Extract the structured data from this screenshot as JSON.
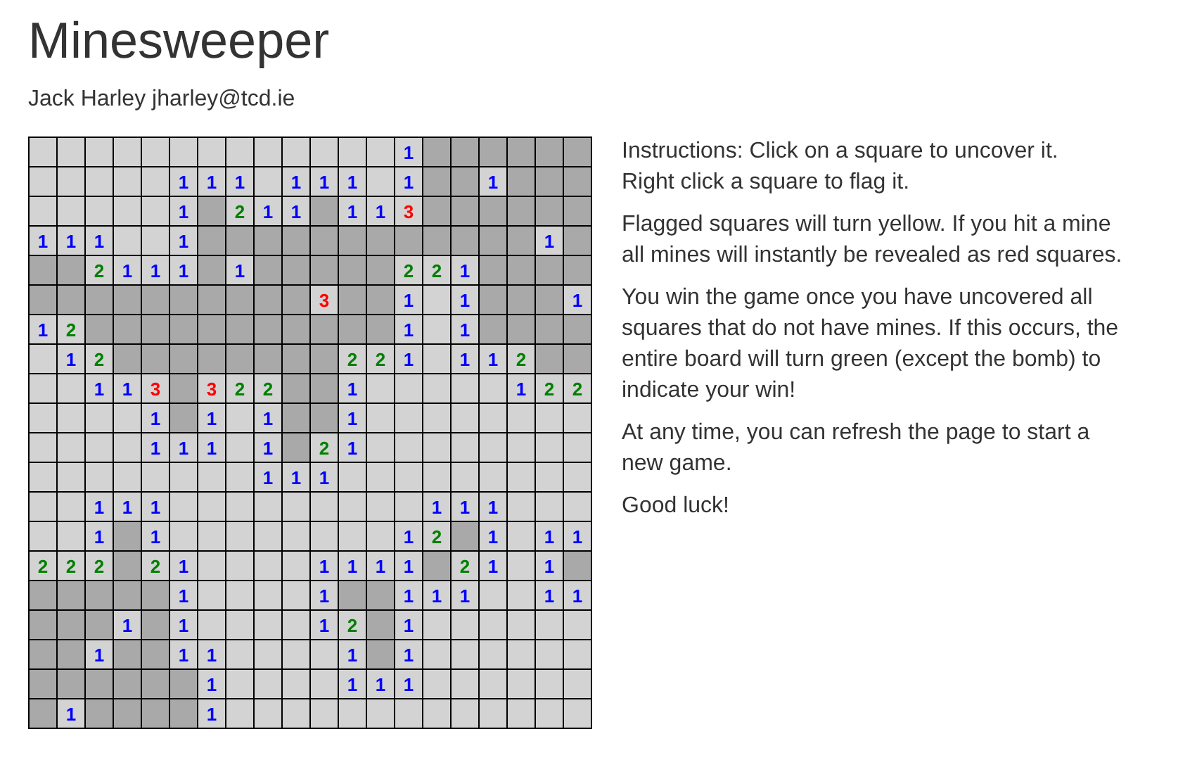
{
  "title": "Minesweeper",
  "author": "Jack Harley jharley@tcd.ie",
  "board": {
    "rows": [
      [
        {
          "revealed": true
        },
        {
          "revealed": true
        },
        {
          "revealed": true
        },
        {
          "revealed": true
        },
        {
          "revealed": true
        },
        {
          "revealed": true
        },
        {
          "revealed": true
        },
        {
          "revealed": true
        },
        {
          "revealed": true
        },
        {
          "revealed": true
        },
        {
          "revealed": true
        },
        {
          "revealed": true
        },
        {
          "revealed": true
        },
        {
          "revealed": true,
          "number": "1",
          "color": "#0000ff"
        },
        {
          "revealed": false
        },
        {
          "revealed": false
        },
        {
          "revealed": false
        },
        {
          "revealed": false
        },
        {
          "revealed": false
        },
        {
          "revealed": false
        }
      ],
      [
        {
          "revealed": true
        },
        {
          "revealed": true
        },
        {
          "revealed": true
        },
        {
          "revealed": true
        },
        {
          "revealed": true
        },
        {
          "revealed": true,
          "number": "1",
          "color": "#0000ff"
        },
        {
          "revealed": true,
          "number": "1",
          "color": "#0000ff"
        },
        {
          "revealed": true,
          "number": "1",
          "color": "#0000ff"
        },
        {
          "revealed": true
        },
        {
          "revealed": true,
          "number": "1",
          "color": "#0000ff"
        },
        {
          "revealed": true,
          "number": "1",
          "color": "#0000ff"
        },
        {
          "revealed": true,
          "number": "1",
          "color": "#0000ff"
        },
        {
          "revealed": true
        },
        {
          "revealed": true,
          "number": "1",
          "color": "#0000ff"
        },
        {
          "revealed": false
        },
        {
          "revealed": false
        },
        {
          "revealed": true,
          "number": "1",
          "color": "#0000ff"
        },
        {
          "revealed": false
        },
        {
          "revealed": false
        },
        {
          "revealed": false
        }
      ],
      [
        {
          "revealed": true
        },
        {
          "revealed": true
        },
        {
          "revealed": true
        },
        {
          "revealed": true
        },
        {
          "revealed": true
        },
        {
          "revealed": true,
          "number": "1",
          "color": "#0000ff"
        },
        {
          "revealed": false
        },
        {
          "revealed": true,
          "number": "2",
          "color": "#008000"
        },
        {
          "revealed": true,
          "number": "1",
          "color": "#0000ff"
        },
        {
          "revealed": true,
          "number": "1",
          "color": "#0000ff"
        },
        {
          "revealed": false
        },
        {
          "revealed": true,
          "number": "1",
          "color": "#0000ff"
        },
        {
          "revealed": true,
          "number": "1",
          "color": "#0000ff"
        },
        {
          "revealed": true,
          "number": "3",
          "color": "#ff0000"
        },
        {
          "revealed": false
        },
        {
          "revealed": false
        },
        {
          "revealed": false
        },
        {
          "revealed": false
        },
        {
          "revealed": false
        },
        {
          "revealed": false
        }
      ],
      [
        {
          "revealed": true,
          "number": "1",
          "color": "#0000ff"
        },
        {
          "revealed": true,
          "number": "1",
          "color": "#0000ff"
        },
        {
          "revealed": true,
          "number": "1",
          "color": "#0000ff"
        },
        {
          "revealed": true
        },
        {
          "revealed": true
        },
        {
          "revealed": true,
          "number": "1",
          "color": "#0000ff"
        },
        {
          "revealed": false
        },
        {
          "revealed": false
        },
        {
          "revealed": false
        },
        {
          "revealed": false
        },
        {
          "revealed": false
        },
        {
          "revealed": false
        },
        {
          "revealed": false
        },
        {
          "revealed": false
        },
        {
          "revealed": false
        },
        {
          "revealed": false
        },
        {
          "revealed": false
        },
        {
          "revealed": false
        },
        {
          "revealed": true,
          "number": "1",
          "color": "#0000ff"
        },
        {
          "revealed": false
        }
      ],
      [
        {
          "revealed": false
        },
        {
          "revealed": false
        },
        {
          "revealed": true,
          "number": "2",
          "color": "#008000"
        },
        {
          "revealed": true,
          "number": "1",
          "color": "#0000ff"
        },
        {
          "revealed": true,
          "number": "1",
          "color": "#0000ff"
        },
        {
          "revealed": true,
          "number": "1",
          "color": "#0000ff"
        },
        {
          "revealed": false
        },
        {
          "revealed": true,
          "number": "1",
          "color": "#0000ff"
        },
        {
          "revealed": false
        },
        {
          "revealed": false
        },
        {
          "revealed": false
        },
        {
          "revealed": false
        },
        {
          "revealed": false
        },
        {
          "revealed": true,
          "number": "2",
          "color": "#008000"
        },
        {
          "revealed": true,
          "number": "2",
          "color": "#008000"
        },
        {
          "revealed": true,
          "number": "1",
          "color": "#0000ff"
        },
        {
          "revealed": false
        },
        {
          "revealed": false
        },
        {
          "revealed": false
        },
        {
          "revealed": false
        }
      ],
      [
        {
          "revealed": false
        },
        {
          "revealed": false
        },
        {
          "revealed": false
        },
        {
          "revealed": false
        },
        {
          "revealed": false
        },
        {
          "revealed": false
        },
        {
          "revealed": false
        },
        {
          "revealed": false
        },
        {
          "revealed": false
        },
        {
          "revealed": false
        },
        {
          "revealed": true,
          "number": "3",
          "color": "#ff0000"
        },
        {
          "revealed": false
        },
        {
          "revealed": false
        },
        {
          "revealed": true,
          "number": "1",
          "color": "#0000ff"
        },
        {
          "revealed": true
        },
        {
          "revealed": true,
          "number": "1",
          "color": "#0000ff"
        },
        {
          "revealed": false
        },
        {
          "revealed": false
        },
        {
          "revealed": false
        },
        {
          "revealed": true,
          "number": "1",
          "color": "#0000ff"
        }
      ],
      [
        {
          "revealed": true,
          "number": "1",
          "color": "#0000ff"
        },
        {
          "revealed": true,
          "number": "2",
          "color": "#008000"
        },
        {
          "revealed": false
        },
        {
          "revealed": false
        },
        {
          "revealed": false
        },
        {
          "revealed": false
        },
        {
          "revealed": false
        },
        {
          "revealed": false
        },
        {
          "revealed": false
        },
        {
          "revealed": false
        },
        {
          "revealed": false
        },
        {
          "revealed": false
        },
        {
          "revealed": false
        },
        {
          "revealed": true,
          "number": "1",
          "color": "#0000ff"
        },
        {
          "revealed": true
        },
        {
          "revealed": true,
          "number": "1",
          "color": "#0000ff"
        },
        {
          "revealed": false
        },
        {
          "revealed": false
        },
        {
          "revealed": false
        },
        {
          "revealed": false
        }
      ],
      [
        {
          "revealed": true
        },
        {
          "revealed": true,
          "number": "1",
          "color": "#0000ff"
        },
        {
          "revealed": true,
          "number": "2",
          "color": "#008000"
        },
        {
          "revealed": false
        },
        {
          "revealed": false
        },
        {
          "revealed": false
        },
        {
          "revealed": false
        },
        {
          "revealed": false
        },
        {
          "revealed": false
        },
        {
          "revealed": false
        },
        {
          "revealed": false
        },
        {
          "revealed": true,
          "number": "2",
          "color": "#008000"
        },
        {
          "revealed": true,
          "number": "2",
          "color": "#008000"
        },
        {
          "revealed": true,
          "number": "1",
          "color": "#0000ff"
        },
        {
          "revealed": true
        },
        {
          "revealed": true,
          "number": "1",
          "color": "#0000ff"
        },
        {
          "revealed": true,
          "number": "1",
          "color": "#0000ff"
        },
        {
          "revealed": true,
          "number": "2",
          "color": "#008000"
        },
        {
          "revealed": false
        },
        {
          "revealed": false
        }
      ],
      [
        {
          "revealed": true
        },
        {
          "revealed": true
        },
        {
          "revealed": true,
          "number": "1",
          "color": "#0000ff"
        },
        {
          "revealed": true,
          "number": "1",
          "color": "#0000ff"
        },
        {
          "revealed": true,
          "number": "3",
          "color": "#ff0000"
        },
        {
          "revealed": false
        },
        {
          "revealed": true,
          "number": "3",
          "color": "#ff0000"
        },
        {
          "revealed": true,
          "number": "2",
          "color": "#008000"
        },
        {
          "revealed": true,
          "number": "2",
          "color": "#008000"
        },
        {
          "revealed": false
        },
        {
          "revealed": false
        },
        {
          "revealed": true,
          "number": "1",
          "color": "#0000ff"
        },
        {
          "revealed": true
        },
        {
          "revealed": true
        },
        {
          "revealed": true
        },
        {
          "revealed": true
        },
        {
          "revealed": true
        },
        {
          "revealed": true,
          "number": "1",
          "color": "#0000ff"
        },
        {
          "revealed": true,
          "number": "2",
          "color": "#008000"
        },
        {
          "revealed": true,
          "number": "2",
          "color": "#008000"
        }
      ],
      [
        {
          "revealed": true
        },
        {
          "revealed": true
        },
        {
          "revealed": true
        },
        {
          "revealed": true
        },
        {
          "revealed": true,
          "number": "1",
          "color": "#0000ff"
        },
        {
          "revealed": false
        },
        {
          "revealed": true,
          "number": "1",
          "color": "#0000ff"
        },
        {
          "revealed": true
        },
        {
          "revealed": true,
          "number": "1",
          "color": "#0000ff"
        },
        {
          "revealed": false
        },
        {
          "revealed": false
        },
        {
          "revealed": true,
          "number": "1",
          "color": "#0000ff"
        },
        {
          "revealed": true
        },
        {
          "revealed": true
        },
        {
          "revealed": true
        },
        {
          "revealed": true
        },
        {
          "revealed": true
        },
        {
          "revealed": true
        },
        {
          "revealed": true
        },
        {
          "revealed": true
        }
      ],
      [
        {
          "revealed": true
        },
        {
          "revealed": true
        },
        {
          "revealed": true
        },
        {
          "revealed": true
        },
        {
          "revealed": true,
          "number": "1",
          "color": "#0000ff"
        },
        {
          "revealed": true,
          "number": "1",
          "color": "#0000ff"
        },
        {
          "revealed": true,
          "number": "1",
          "color": "#0000ff"
        },
        {
          "revealed": true
        },
        {
          "revealed": true,
          "number": "1",
          "color": "#0000ff"
        },
        {
          "revealed": false
        },
        {
          "revealed": true,
          "number": "2",
          "color": "#008000"
        },
        {
          "revealed": true,
          "number": "1",
          "color": "#0000ff"
        },
        {
          "revealed": true
        },
        {
          "revealed": true
        },
        {
          "revealed": true
        },
        {
          "revealed": true
        },
        {
          "revealed": true
        },
        {
          "revealed": true
        },
        {
          "revealed": true
        },
        {
          "revealed": true
        }
      ],
      [
        {
          "revealed": true
        },
        {
          "revealed": true
        },
        {
          "revealed": true
        },
        {
          "revealed": true
        },
        {
          "revealed": true
        },
        {
          "revealed": true
        },
        {
          "revealed": true
        },
        {
          "revealed": true
        },
        {
          "revealed": true,
          "number": "1",
          "color": "#0000ff"
        },
        {
          "revealed": true,
          "number": "1",
          "color": "#0000ff"
        },
        {
          "revealed": true,
          "number": "1",
          "color": "#0000ff"
        },
        {
          "revealed": true
        },
        {
          "revealed": true
        },
        {
          "revealed": true
        },
        {
          "revealed": true
        },
        {
          "revealed": true
        },
        {
          "revealed": true
        },
        {
          "revealed": true
        },
        {
          "revealed": true
        },
        {
          "revealed": true
        }
      ],
      [
        {
          "revealed": true
        },
        {
          "revealed": true
        },
        {
          "revealed": true,
          "number": "1",
          "color": "#0000ff"
        },
        {
          "revealed": true,
          "number": "1",
          "color": "#0000ff"
        },
        {
          "revealed": true,
          "number": "1",
          "color": "#0000ff"
        },
        {
          "revealed": true
        },
        {
          "revealed": true
        },
        {
          "revealed": true
        },
        {
          "revealed": true
        },
        {
          "revealed": true
        },
        {
          "revealed": true
        },
        {
          "revealed": true
        },
        {
          "revealed": true
        },
        {
          "revealed": true
        },
        {
          "revealed": true,
          "number": "1",
          "color": "#0000ff"
        },
        {
          "revealed": true,
          "number": "1",
          "color": "#0000ff"
        },
        {
          "revealed": true,
          "number": "1",
          "color": "#0000ff"
        },
        {
          "revealed": true
        },
        {
          "revealed": true
        },
        {
          "revealed": true
        }
      ],
      [
        {
          "revealed": true
        },
        {
          "revealed": true
        },
        {
          "revealed": true,
          "number": "1",
          "color": "#0000ff"
        },
        {
          "revealed": false
        },
        {
          "revealed": true,
          "number": "1",
          "color": "#0000ff"
        },
        {
          "revealed": true
        },
        {
          "revealed": true
        },
        {
          "revealed": true
        },
        {
          "revealed": true
        },
        {
          "revealed": true
        },
        {
          "revealed": true
        },
        {
          "revealed": true
        },
        {
          "revealed": true
        },
        {
          "revealed": true,
          "number": "1",
          "color": "#0000ff"
        },
        {
          "revealed": true,
          "number": "2",
          "color": "#008000"
        },
        {
          "revealed": false
        },
        {
          "revealed": true,
          "number": "1",
          "color": "#0000ff"
        },
        {
          "revealed": true
        },
        {
          "revealed": true,
          "number": "1",
          "color": "#0000ff"
        },
        {
          "revealed": true,
          "number": "1",
          "color": "#0000ff"
        }
      ],
      [
        {
          "revealed": true,
          "number": "2",
          "color": "#008000"
        },
        {
          "revealed": true,
          "number": "2",
          "color": "#008000"
        },
        {
          "revealed": true,
          "number": "2",
          "color": "#008000"
        },
        {
          "revealed": false
        },
        {
          "revealed": true,
          "number": "2",
          "color": "#008000"
        },
        {
          "revealed": true,
          "number": "1",
          "color": "#0000ff"
        },
        {
          "revealed": true
        },
        {
          "revealed": true
        },
        {
          "revealed": true
        },
        {
          "revealed": true
        },
        {
          "revealed": true,
          "number": "1",
          "color": "#0000ff"
        },
        {
          "revealed": true,
          "number": "1",
          "color": "#0000ff"
        },
        {
          "revealed": true,
          "number": "1",
          "color": "#0000ff"
        },
        {
          "revealed": true,
          "number": "1",
          "color": "#0000ff"
        },
        {
          "revealed": false
        },
        {
          "revealed": true,
          "number": "2",
          "color": "#008000"
        },
        {
          "revealed": true,
          "number": "1",
          "color": "#0000ff"
        },
        {
          "revealed": true
        },
        {
          "revealed": true,
          "number": "1",
          "color": "#0000ff"
        },
        {
          "revealed": false
        }
      ],
      [
        {
          "revealed": false
        },
        {
          "revealed": false
        },
        {
          "revealed": false
        },
        {
          "revealed": false
        },
        {
          "revealed": false
        },
        {
          "revealed": true,
          "number": "1",
          "color": "#0000ff"
        },
        {
          "revealed": true
        },
        {
          "revealed": true
        },
        {
          "revealed": true
        },
        {
          "revealed": true
        },
        {
          "revealed": true,
          "number": "1",
          "color": "#0000ff"
        },
        {
          "revealed": false
        },
        {
          "revealed": false
        },
        {
          "revealed": true,
          "number": "1",
          "color": "#0000ff"
        },
        {
          "revealed": true,
          "number": "1",
          "color": "#0000ff"
        },
        {
          "revealed": true,
          "number": "1",
          "color": "#0000ff"
        },
        {
          "revealed": true
        },
        {
          "revealed": true
        },
        {
          "revealed": true,
          "number": "1",
          "color": "#0000ff"
        },
        {
          "revealed": true,
          "number": "1",
          "color": "#0000ff"
        }
      ],
      [
        {
          "revealed": false
        },
        {
          "revealed": false
        },
        {
          "revealed": false
        },
        {
          "revealed": true,
          "number": "1",
          "color": "#0000ff"
        },
        {
          "revealed": false
        },
        {
          "revealed": true,
          "number": "1",
          "color": "#0000ff"
        },
        {
          "revealed": true
        },
        {
          "revealed": true
        },
        {
          "revealed": true
        },
        {
          "revealed": true
        },
        {
          "revealed": true,
          "number": "1",
          "color": "#0000ff"
        },
        {
          "revealed": true,
          "number": "2",
          "color": "#008000"
        },
        {
          "revealed": false
        },
        {
          "revealed": true,
          "number": "1",
          "color": "#0000ff"
        },
        {
          "revealed": true
        },
        {
          "revealed": true
        },
        {
          "revealed": true
        },
        {
          "revealed": true
        },
        {
          "revealed": true
        },
        {
          "revealed": true
        }
      ],
      [
        {
          "revealed": false
        },
        {
          "revealed": false
        },
        {
          "revealed": true,
          "number": "1",
          "color": "#0000ff"
        },
        {
          "revealed": false
        },
        {
          "revealed": false
        },
        {
          "revealed": true,
          "number": "1",
          "color": "#0000ff"
        },
        {
          "revealed": true,
          "number": "1",
          "color": "#0000ff"
        },
        {
          "revealed": true
        },
        {
          "revealed": true
        },
        {
          "revealed": true
        },
        {
          "revealed": true
        },
        {
          "revealed": true,
          "number": "1",
          "color": "#0000ff"
        },
        {
          "revealed": false
        },
        {
          "revealed": true,
          "number": "1",
          "color": "#0000ff"
        },
        {
          "revealed": true
        },
        {
          "revealed": true
        },
        {
          "revealed": true
        },
        {
          "revealed": true
        },
        {
          "revealed": true
        },
        {
          "revealed": true
        }
      ],
      [
        {
          "revealed": false
        },
        {
          "revealed": false
        },
        {
          "revealed": false
        },
        {
          "revealed": false
        },
        {
          "revealed": false
        },
        {
          "revealed": false
        },
        {
          "revealed": true,
          "number": "1",
          "color": "#0000ff"
        },
        {
          "revealed": true
        },
        {
          "revealed": true
        },
        {
          "revealed": true
        },
        {
          "revealed": true
        },
        {
          "revealed": true,
          "number": "1",
          "color": "#0000ff"
        },
        {
          "revealed": true,
          "number": "1",
          "color": "#0000ff"
        },
        {
          "revealed": true,
          "number": "1",
          "color": "#0000ff"
        },
        {
          "revealed": true
        },
        {
          "revealed": true
        },
        {
          "revealed": true
        },
        {
          "revealed": true
        },
        {
          "revealed": true
        },
        {
          "revealed": true
        }
      ],
      [
        {
          "revealed": false
        },
        {
          "revealed": true,
          "number": "1",
          "color": "#0000ff"
        },
        {
          "revealed": false
        },
        {
          "revealed": false
        },
        {
          "revealed": false
        },
        {
          "revealed": false
        },
        {
          "revealed": true,
          "number": "1",
          "color": "#0000ff"
        },
        {
          "revealed": true
        },
        {
          "revealed": true
        },
        {
          "revealed": true
        },
        {
          "revealed": true
        },
        {
          "revealed": true
        },
        {
          "revealed": true
        },
        {
          "revealed": true
        },
        {
          "revealed": true
        },
        {
          "revealed": true
        },
        {
          "revealed": true
        },
        {
          "revealed": true
        },
        {
          "revealed": true
        },
        {
          "revealed": true
        }
      ]
    ]
  },
  "instructions": [
    "Instructions: Click on a square to uncover it.\nRight click a square to flag it.",
    "Flagged squares will turn yellow. If you hit a mine all mines will instantly be revealed as red squares.",
    "You win the game once you have uncovered all squares that do not have mines. If this occurs, the entire board will turn green (except the bomb) to indicate your win!",
    "At any time, you can refresh the page to start a new game.",
    "Good luck!"
  ]
}
